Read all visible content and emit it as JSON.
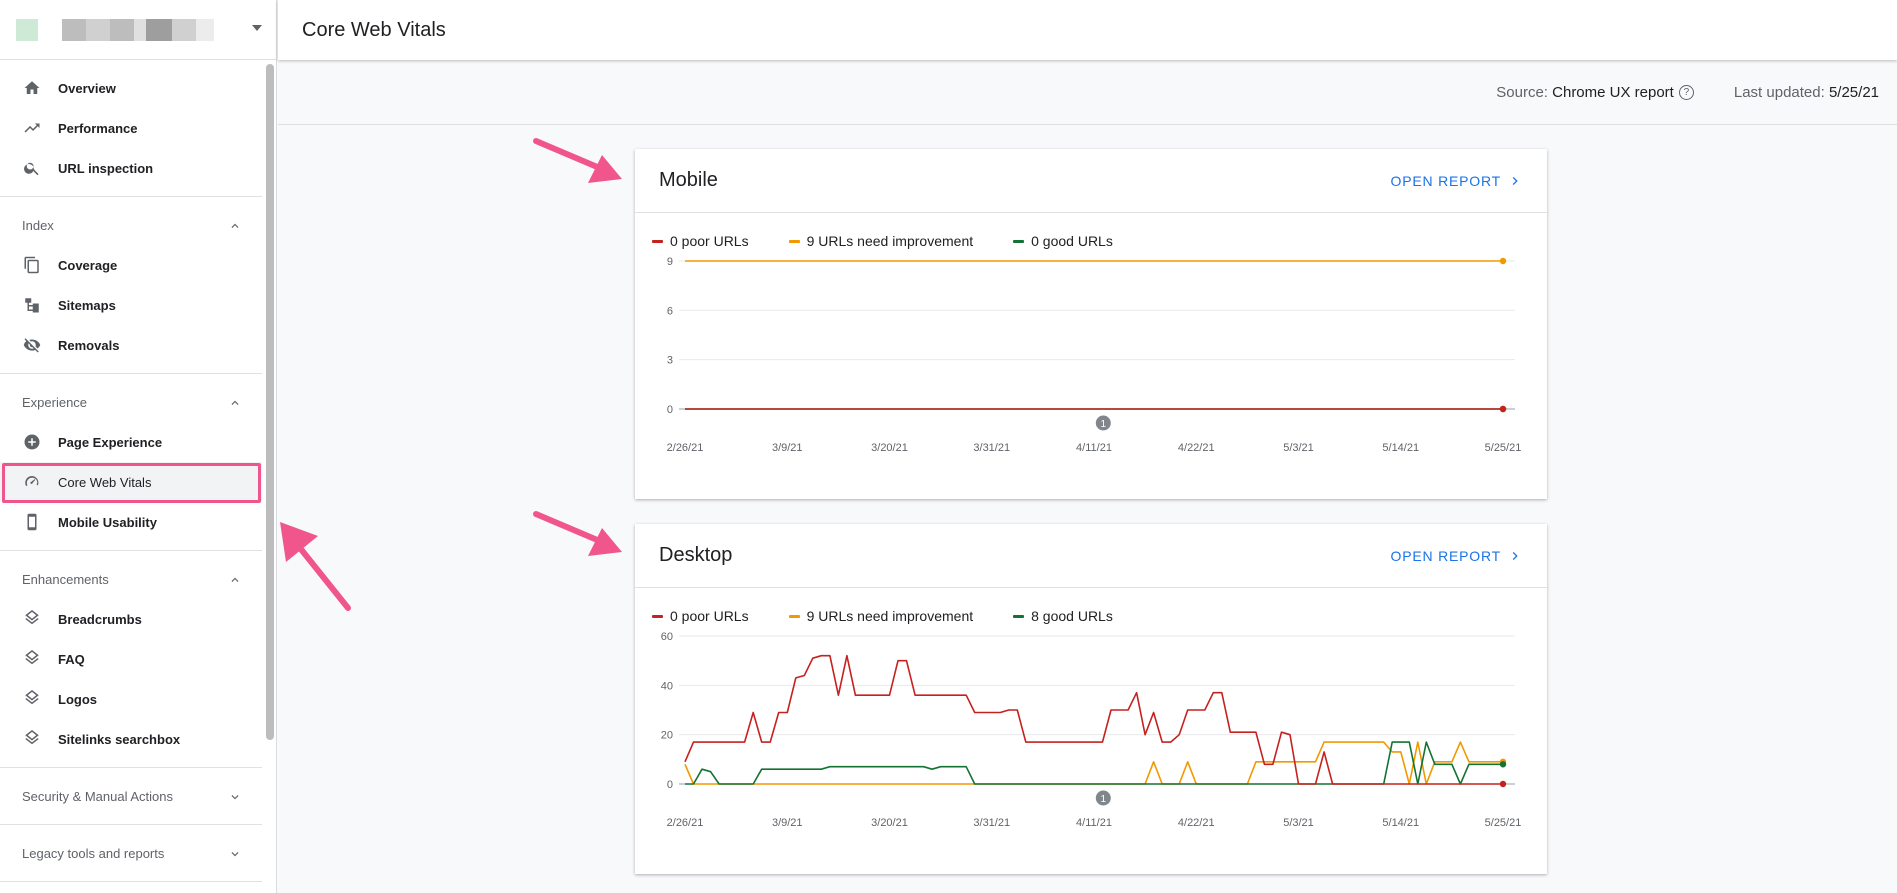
{
  "header": {
    "title": "Core Web Vitals"
  },
  "subheader": {
    "source_label": "Source:",
    "source_value": "Chrome UX report",
    "updated_label": "Last updated:",
    "updated_value": "5/25/21"
  },
  "sidebar": {
    "top_items": [
      {
        "label": "Overview",
        "icon": "home-icon"
      },
      {
        "label": "Performance",
        "icon": "trending-up-icon"
      },
      {
        "label": "URL inspection",
        "icon": "search-icon"
      }
    ],
    "sections": [
      {
        "title": "Index",
        "expanded": true,
        "items": [
          {
            "label": "Coverage",
            "icon": "coverage-icon"
          },
          {
            "label": "Sitemaps",
            "icon": "sitemap-icon"
          },
          {
            "label": "Removals",
            "icon": "eye-off-icon"
          }
        ]
      },
      {
        "title": "Experience",
        "expanded": true,
        "items": [
          {
            "label": "Page Experience",
            "icon": "plus-circle-icon"
          },
          {
            "label": "Core Web Vitals",
            "icon": "speedometer-icon",
            "active": true
          },
          {
            "label": "Mobile Usability",
            "icon": "phone-icon"
          }
        ]
      },
      {
        "title": "Enhancements",
        "expanded": true,
        "items": [
          {
            "label": "Breadcrumbs",
            "icon": "layers-icon"
          },
          {
            "label": "FAQ",
            "icon": "layers-icon"
          },
          {
            "label": "Logos",
            "icon": "layers-icon"
          },
          {
            "label": "Sitelinks searchbox",
            "icon": "layers-icon"
          }
        ]
      },
      {
        "title": "Security & Manual Actions",
        "expanded": false,
        "items": []
      },
      {
        "title": "Legacy tools and reports",
        "expanded": false,
        "items": []
      }
    ]
  },
  "colors": {
    "poor": "#c5221f",
    "needs_improvement": "#f29900",
    "good": "#137333",
    "accent": "#1a73e8",
    "highlight": "#f0568c"
  },
  "cards": [
    {
      "title": "Mobile",
      "open_label": "OPEN REPORT",
      "legend": [
        "0 poor URLs",
        "9 URLs need improvement",
        "0 good URLs"
      ]
    },
    {
      "title": "Desktop",
      "open_label": "OPEN REPORT",
      "legend": [
        "0 poor URLs",
        "9 URLs need improvement",
        "8 good URLs"
      ]
    }
  ],
  "chart_data": [
    {
      "type": "line",
      "title": "Mobile",
      "x_ticks": [
        "2/26/21",
        "3/9/21",
        "3/20/21",
        "3/31/21",
        "4/11/21",
        "4/22/21",
        "5/3/21",
        "5/14/21",
        "5/25/21"
      ],
      "y_ticks": [
        0,
        3,
        6,
        9
      ],
      "ylim": [
        0,
        9
      ],
      "annotation_marker": {
        "label": "1",
        "date": "4/12/21"
      },
      "series": [
        {
          "name": "0 poor URLs",
          "color": "#c5221f",
          "values": [
            0,
            0,
            0,
            0,
            0,
            0,
            0,
            0,
            0
          ]
        },
        {
          "name": "9 URLs need improvement",
          "color": "#f29900",
          "values": [
            9,
            9,
            9,
            9,
            9,
            9,
            9,
            9,
            9
          ]
        },
        {
          "name": "0 good URLs",
          "color": "#137333",
          "values": [
            0,
            0,
            0,
            0,
            0,
            0,
            0,
            0,
            0
          ]
        }
      ]
    },
    {
      "type": "line",
      "title": "Desktop",
      "x_ticks": [
        "2/26/21",
        "3/9/21",
        "3/20/21",
        "3/31/21",
        "4/11/21",
        "4/22/21",
        "5/3/21",
        "5/14/21",
        "5/25/21"
      ],
      "y_ticks": [
        0,
        20,
        40,
        60
      ],
      "ylim": [
        0,
        60
      ],
      "annotation_marker": {
        "label": "1",
        "date": "4/12/21"
      },
      "series": [
        {
          "name": "0 poor URLs",
          "color": "#c5221f",
          "values": [
            9,
            17,
            17,
            17,
            17,
            17,
            17,
            17,
            29,
            17,
            17,
            29,
            29,
            43,
            44,
            51,
            52,
            52,
            36,
            52,
            36,
            36,
            36,
            36,
            36,
            50,
            50,
            36,
            36,
            36,
            36,
            36,
            36,
            36,
            29,
            29,
            29,
            29,
            30,
            30,
            17,
            17,
            17,
            17,
            17,
            17,
            17,
            17,
            17,
            17,
            30,
            30,
            30,
            37,
            20,
            29,
            17,
            17,
            20,
            30,
            30,
            30,
            37,
            37,
            21,
            21,
            21,
            21,
            8,
            8,
            21,
            20,
            0,
            0,
            0,
            13,
            0,
            0,
            0,
            0,
            0,
            0,
            0,
            0,
            0,
            0,
            0,
            0,
            0,
            0,
            0,
            0,
            0,
            0,
            0,
            0,
            0
          ]
        },
        {
          "name": "9 URLs need improvement",
          "color": "#f29900",
          "values": [
            8,
            0,
            0,
            0,
            0,
            0,
            0,
            0,
            0,
            0,
            0,
            0,
            0,
            0,
            0,
            0,
            0,
            0,
            0,
            0,
            0,
            0,
            0,
            0,
            0,
            0,
            0,
            0,
            0,
            0,
            0,
            0,
            0,
            0,
            0,
            0,
            0,
            0,
            0,
            0,
            0,
            0,
            0,
            0,
            0,
            0,
            0,
            0,
            0,
            0,
            0,
            0,
            0,
            0,
            0,
            9,
            0,
            0,
            0,
            9,
            0,
            0,
            0,
            0,
            0,
            0,
            0,
            9,
            9,
            9,
            9,
            9,
            9,
            9,
            9,
            17,
            17,
            17,
            17,
            17,
            17,
            17,
            17,
            13,
            13,
            0,
            17,
            0,
            9,
            9,
            9,
            17,
            9,
            9,
            9,
            9,
            9
          ]
        },
        {
          "name": "8 good URLs",
          "color": "#137333",
          "values": [
            0,
            0,
            6,
            5,
            0,
            0,
            0,
            0,
            0,
            6,
            6,
            6,
            6,
            6,
            6,
            6,
            6,
            7,
            7,
            7,
            7,
            7,
            7,
            7,
            7,
            7,
            7,
            7,
            7,
            6,
            7,
            7,
            7,
            7,
            0,
            0,
            0,
            0,
            0,
            0,
            0,
            0,
            0,
            0,
            0,
            0,
            0,
            0,
            0,
            0,
            0,
            0,
            0,
            0,
            0,
            0,
            0,
            0,
            0,
            0,
            0,
            0,
            0,
            0,
            0,
            0,
            0,
            0,
            0,
            0,
            0,
            0,
            0,
            0,
            0,
            0,
            0,
            0,
            0,
            0,
            0,
            0,
            0,
            17,
            17,
            17,
            0,
            17,
            8,
            8,
            8,
            0,
            8,
            8,
            8,
            8,
            8
          ]
        }
      ]
    }
  ]
}
